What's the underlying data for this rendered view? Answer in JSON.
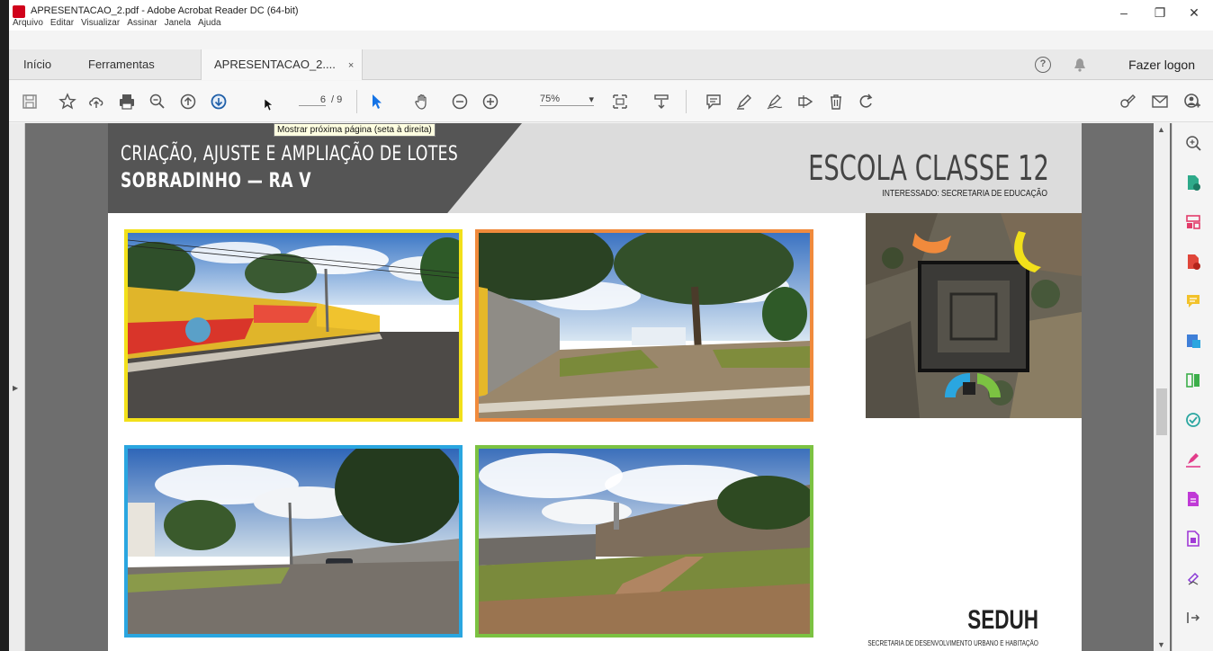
{
  "window": {
    "title": "APRESENTACAO_2.pdf - Adobe Acrobat Reader DC (64-bit)",
    "minimize": "–",
    "restore": "❐",
    "close": "✕"
  },
  "menu": [
    "Arquivo",
    "Editar",
    "Visualizar",
    "Assinar",
    "Janela",
    "Ajuda"
  ],
  "tabs": {
    "home": "Início",
    "tools": "Ferramentas",
    "doc": "APRESENTACAO_2....",
    "doc_close": "×",
    "help": "?",
    "logon": "Fazer logon"
  },
  "toolbar": {
    "current_page": "6",
    "total_pages": "/ 9",
    "zoom": "75%",
    "tooltip": "Mostrar próxima página (seta à direita)"
  },
  "page": {
    "banner_line1": "CRIAÇÃO, AJUSTE E AMPLIAÇÃO DE LOTES",
    "banner_line2": "SOBRADINHO — RA V",
    "school": "ESCOLA CLASSE 12",
    "interested": "INTERESSADO: SECRETARIA DE EDUCAÇÃO",
    "logo": "SEDUH",
    "logo_sub": "SECRETARIA DE DESENVOLVIMENTO URBANO E HABITAÇÃO"
  },
  "colors": {
    "accent_yellow": "#f2e01a",
    "accent_orange": "#f08a3c",
    "accent_blue": "#2aa6e0",
    "accent_green": "#7cc242",
    "acrobat_red": "#d0021b",
    "selection_blue": "#1473e6"
  }
}
